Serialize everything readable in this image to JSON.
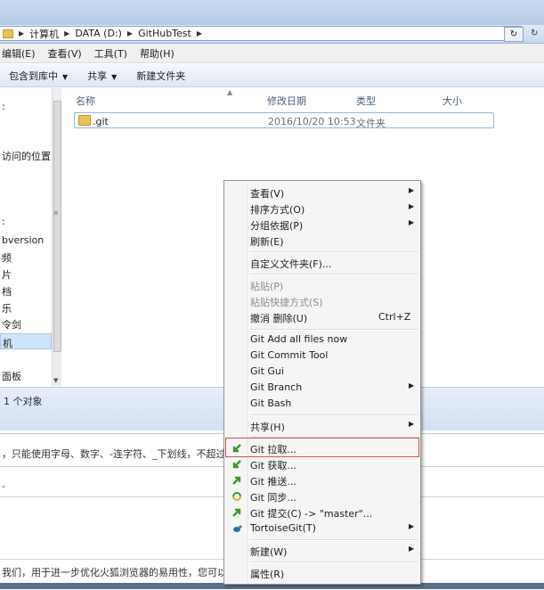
{
  "address": {
    "crumbs": [
      "计算机",
      "DATA (D:)",
      "GitHubTest"
    ],
    "refresh_glyph": "↻",
    "extra_glyph": "↻"
  },
  "menubar": {
    "items": [
      "编辑(E)",
      "查看(V)",
      "工具(T)",
      "帮助(H)"
    ]
  },
  "toolbar": {
    "include_in_library": "包含到库中",
    "share": "共享",
    "new_folder": "新建文件夹"
  },
  "navpane": {
    "items": [
      ":",
      "访问的位置",
      ":",
      "bversion",
      "频",
      "片",
      "档",
      "乐",
      "令剑",
      "机",
      "面板"
    ]
  },
  "columns": {
    "name": "名称",
    "modified": "修改日期",
    "type": "类型",
    "size": "大小"
  },
  "files": [
    {
      "name": ".git",
      "modified": "2016/10/20 10:53",
      "type": "文件夹",
      "size": ""
    }
  ],
  "status": {
    "count": "1 个对象"
  },
  "page_behind": {
    "line1": "，只能使用字母、数字、-连字符、_下划线，不超过150",
    "line2": "-",
    "line3": "我们，用于进一步优化火狐浏览器的易用性，您可以自由"
  },
  "context_menu": {
    "view": "查看(V)",
    "sort_by": "排序方式(O)",
    "group_by": "分组依据(P)",
    "refresh": "刷新(E)",
    "customize_folder": "自定义文件夹(F)...",
    "paste": "粘贴(P)",
    "paste_shortcut": "粘贴快捷方式(S)",
    "undo_delete": "撤消 删除(U)",
    "undo_shortcut": "Ctrl+Z",
    "git_add_all": "Git Add all files now",
    "git_commit_tool": "Git Commit Tool",
    "git_gui": "Git Gui",
    "git_branch": "Git Branch",
    "git_bash": "Git Bash",
    "share": "共享(H)",
    "git_pull": "Git 拉取...",
    "git_fetch": "Git 获取...",
    "git_push": "Git 推送...",
    "git_sync": "Git 同步...",
    "git_commit": "Git 提交(C) -> \"master\"...",
    "tortoisegit": "TortoiseGit(T)",
    "new": "新建(W)",
    "properties": "属性(R)"
  },
  "colors": {
    "highlight_border": "#d9504a",
    "tortoise_green": "#3a9a2a"
  }
}
